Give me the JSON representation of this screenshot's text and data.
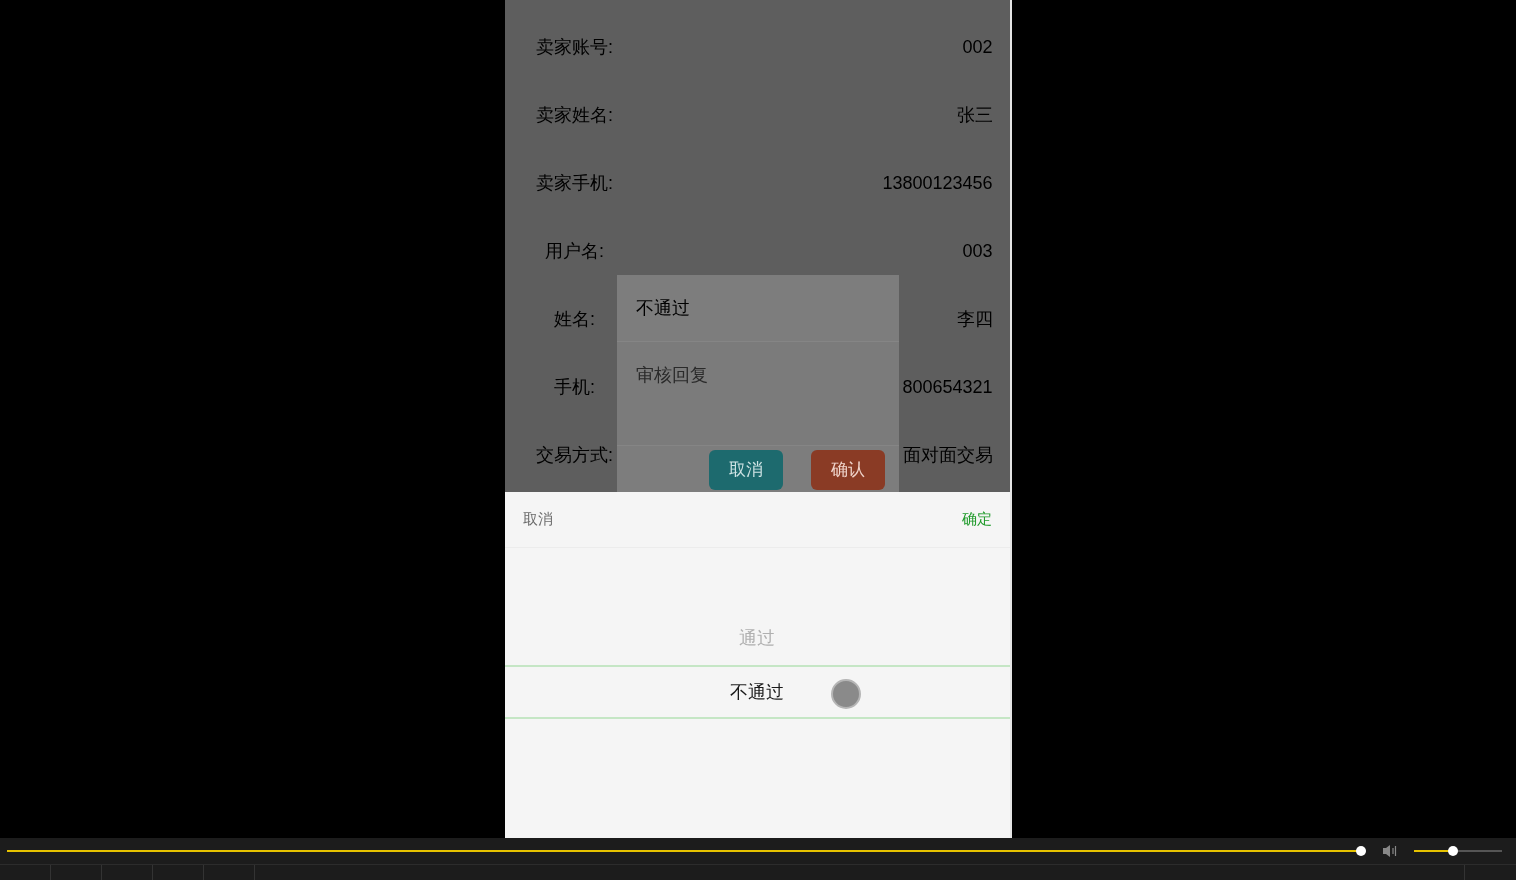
{
  "detail_rows": [
    {
      "label": "卖家账号:",
      "value": "002"
    },
    {
      "label": "卖家姓名:",
      "value": "张三"
    },
    {
      "label": "卖家手机:",
      "value": "13800123456"
    },
    {
      "label": "用户名:",
      "value": "003"
    },
    {
      "label": "姓名:",
      "value": "李四"
    },
    {
      "label": "手机:",
      "value": "800654321"
    },
    {
      "label": "交易方式:",
      "value": "面对面交易"
    }
  ],
  "dialog": {
    "status_value": "不通过",
    "reply_placeholder": "审核回复",
    "buttons": [
      {
        "label": "取消",
        "kind": "cancel"
      },
      {
        "label": "确认",
        "kind": "confirm"
      }
    ]
  },
  "picker": {
    "cancel": "取消",
    "confirm": "确定",
    "options": [
      {
        "label": "通过",
        "selected": false
      },
      {
        "label": "不通过",
        "selected": true
      }
    ]
  },
  "player": {
    "progress": {
      "level": 0.996
    },
    "volume": {
      "level": 0.44
    }
  }
}
